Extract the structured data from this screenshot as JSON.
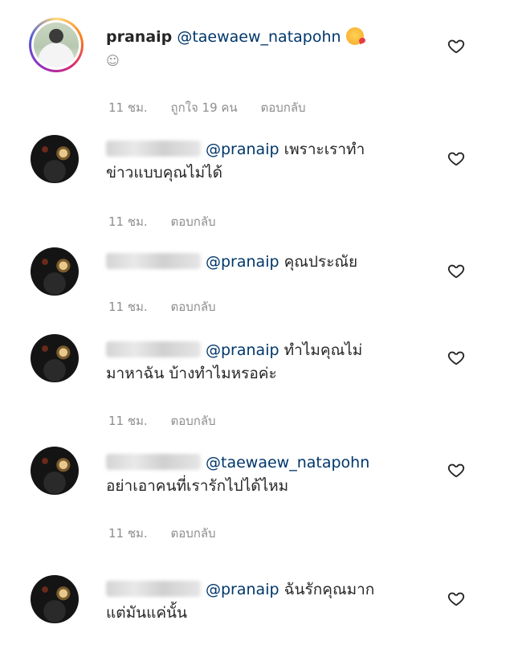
{
  "comments": [
    {
      "username": "pranaip",
      "mention": "@taewaew_natapohn",
      "text": "",
      "second_line": "☺",
      "time": "11 ชม.",
      "likes": "ถูกใจ 19 คน",
      "reply": "ตอบกลับ"
    },
    {
      "mention": "@pranaip",
      "text": "เพราะเราทำ",
      "second_line": "ข่าวแบบคุณไม่ได้",
      "time": "11 ชม.",
      "reply": "ตอบกลับ"
    },
    {
      "mention": "@pranaip",
      "text": "คุณประณัย",
      "time": "11 ชม.",
      "reply": "ตอบกลับ"
    },
    {
      "mention": "@pranaip",
      "text": "ทำไมคุณไม่",
      "second_line": "มาหาฉัน บ้างทำไมหรอค่ะ",
      "time": "11 ชม.",
      "reply": "ตอบกลับ"
    },
    {
      "mention": "@taewaew_natapohn",
      "text": "",
      "second_line": "อย่าเอาคนที่เรารักไปได้ไหม",
      "time": "11 ชม.",
      "reply": "ตอบกลับ"
    },
    {
      "mention": "@pranaip",
      "text": "ฉันรักคุณมาก",
      "second_line": "แต่มันแค่นั้น"
    }
  ],
  "icons": {
    "heart": "heart-outline-icon",
    "emoji": "kissing-face-emoji-icon"
  }
}
